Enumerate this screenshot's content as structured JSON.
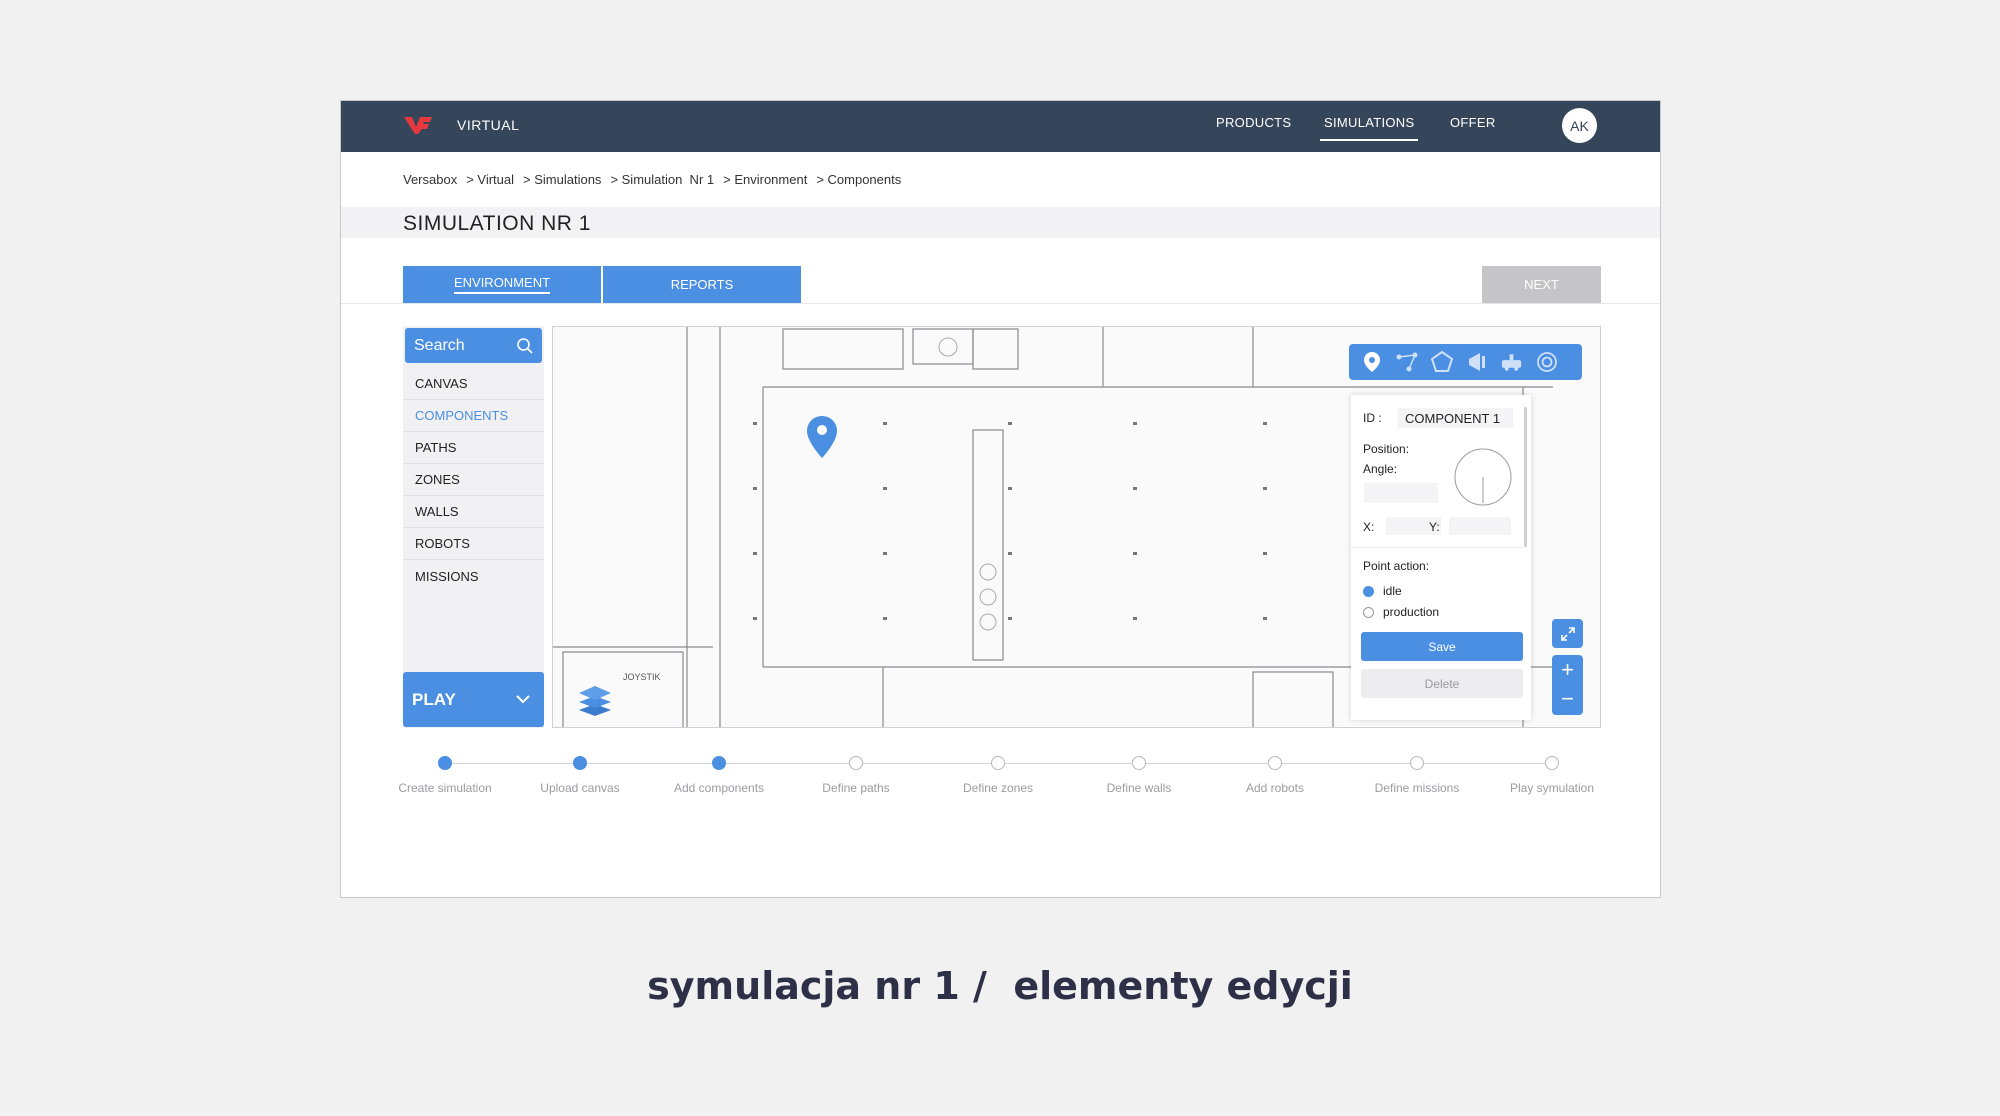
{
  "header": {
    "brand": "VIRTUAL",
    "nav": [
      "PRODUCTS",
      "SIMULATIONS",
      "OFFER"
    ],
    "avatar": "AK",
    "logo_color": "#e8383d"
  },
  "breadcrumb": [
    "Versabox",
    "> Virtual",
    "> Simulations",
    "> Simulation  Nr 1",
    "> Environment",
    "> Components"
  ],
  "page_title": "SIMULATION NR 1",
  "tabs": [
    "ENVIRONMENT",
    "REPORTS"
  ],
  "next_label": "NEXT",
  "sidebar": {
    "search_placeholder": "Search",
    "items": [
      "CANVAS",
      "COMPONENTS",
      "PATHS",
      "ZONES",
      "WALLS",
      "ROBOTS",
      "MISSIONS"
    ],
    "active_item": "COMPONENTS",
    "play_label": "PLAY"
  },
  "toolbar_icons": [
    "location-pin-icon",
    "path-nodes-icon",
    "zone-polygon-icon",
    "wall-icon",
    "robot-icon",
    "target-icon"
  ],
  "properties": {
    "id_label": "ID :",
    "id_value": "COMPONENT 1",
    "position_label": "Position:",
    "angle_label": "Angle:",
    "x_label": "X:",
    "y_label": "Y:",
    "point_action_label": "Point action:",
    "options": [
      "idle",
      "production"
    ],
    "selected_option": "idle",
    "save_label": "Save",
    "delete_label": "Delete"
  },
  "zoom": {
    "in": "+",
    "out": "−"
  },
  "steps": [
    {
      "label": "Create simulation",
      "done": true
    },
    {
      "label": "Upload canvas",
      "done": true
    },
    {
      "label": "Add components",
      "done": true
    },
    {
      "label": "Define paths",
      "done": false
    },
    {
      "label": "Define zones",
      "done": false
    },
    {
      "label": "Define walls",
      "done": false
    },
    {
      "label": "Add robots",
      "done": false
    },
    {
      "label": "Define missions",
      "done": false
    },
    {
      "label": "Play symulation",
      "done": false
    }
  ],
  "caption": "symulacja nr 1 /  elementy edycji",
  "colors": {
    "accent": "#4a8fe2",
    "navbar": "#36465a",
    "disabled": "#c5c5c9"
  }
}
